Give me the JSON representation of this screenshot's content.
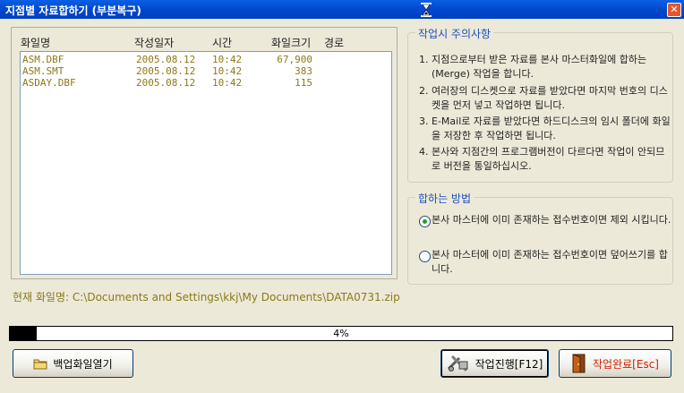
{
  "window": {
    "title": "지점별 자료합하기 (부분복구)",
    "close_icon": "close-icon"
  },
  "file_list": {
    "headers": [
      "화일명",
      "작성일자",
      "시간",
      "화일크기",
      "경로"
    ],
    "rows": [
      {
        "name": "ASM.DBF",
        "date": "2005.08.12",
        "time": "10:42",
        "size": "67,900"
      },
      {
        "name": "ASM.SMT",
        "date": "2005.08.12",
        "time": "10:42",
        "size": "383"
      },
      {
        "name": "ASDAY.DBF",
        "date": "2005.08.12",
        "time": "10:42",
        "size": "115"
      }
    ]
  },
  "notes": {
    "title": "작업시 주의사항",
    "items": [
      {
        "num": "1.",
        "text": "지점으로부터 받은 자료를 본사 마스터화일에 합하는(Merge) 작업을 합니다."
      },
      {
        "num": "2.",
        "text": "여러장의 디스켓으로 자료를 받았다면 마지막 번호의 디스켓을 먼저 넣고 작업하면 됩니다."
      },
      {
        "num": "3.",
        "text": "E-Mail로 자료를 받았다면 하드디스크의 임시 폴더에 화일을 저장한 후 작업하면 됩니다."
      },
      {
        "num": "4.",
        "text": "본사와 지점간의 프로그램버전이 다르다면 작업이 안되므로 버전을 통일하십시오."
      }
    ]
  },
  "method": {
    "title": "합하는 방법",
    "options": [
      {
        "label": "본사 마스터에 이미 존재하는 접수번호이면 제외 시킵니다.",
        "checked": true
      },
      {
        "label": "본사 마스터에 이미 존재하는 접수번호이면 덮어쓰기를 합니다.",
        "checked": false
      }
    ]
  },
  "current_file": "현재 화일명: C:\\Documents and Settings\\kkj\\My Documents\\DATA0731.zip",
  "progress": {
    "value": 4,
    "label": "4%"
  },
  "buttons": {
    "open_backup": "백업화일열기",
    "run": "작업진행[F12]",
    "done": "작업완료[Esc]"
  }
}
